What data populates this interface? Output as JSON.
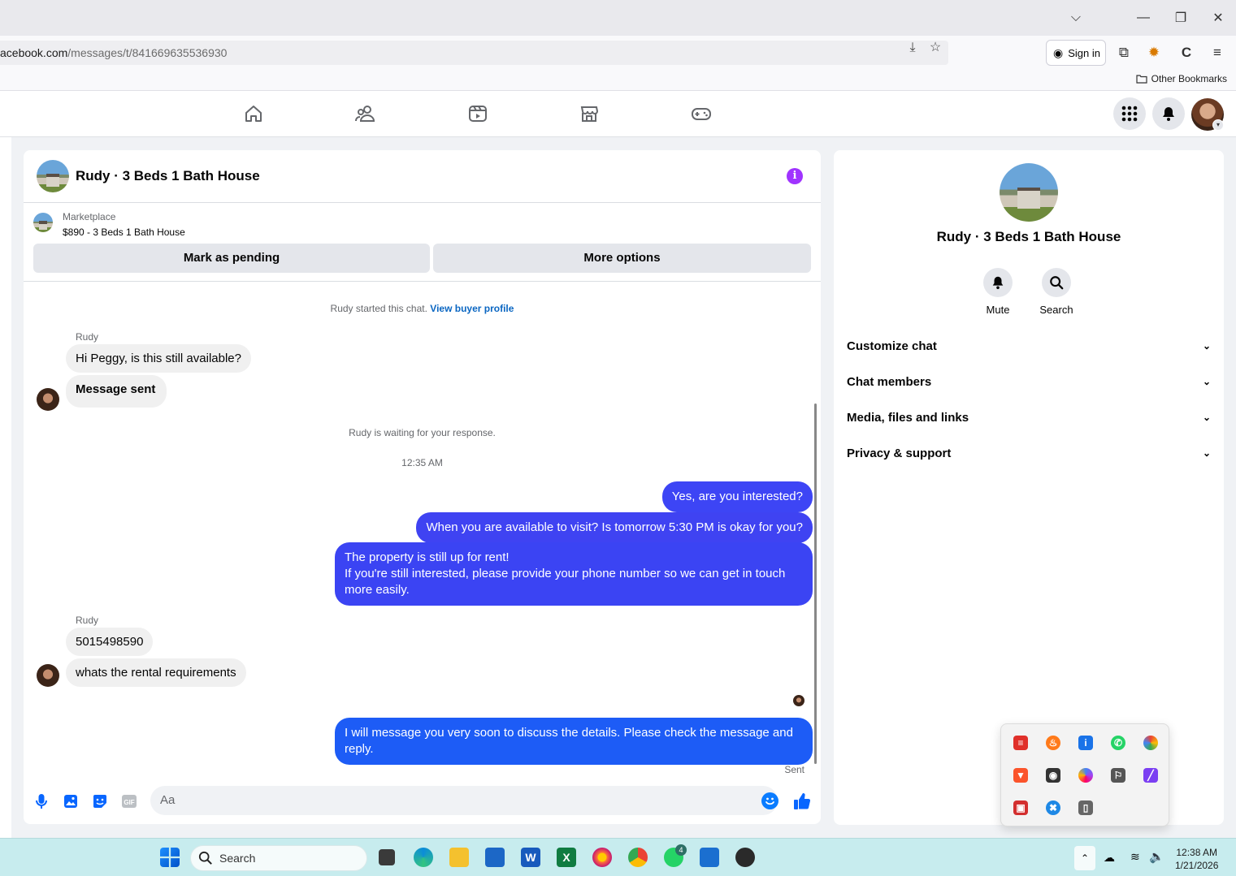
{
  "browser": {
    "url_host": "acebook.com",
    "url_path": "/messages/t/841669635536930",
    "sign_in_label": "Sign in",
    "other_bookmarks_label": "Other Bookmarks"
  },
  "chat": {
    "title": "Rudy · 3 Beds 1 Bath House",
    "marketplace_label": "Marketplace",
    "listing": "$890 - 3 Beds 1 Bath House",
    "mark_pending_label": "Mark as pending",
    "more_options_label": "More options",
    "started_text": "Rudy started this chat.",
    "view_buyer_label": "View buyer profile",
    "sender_name": "Rudy",
    "msg_in_1": "Hi Peggy, is this still available?",
    "msg_in_2": "Message sent",
    "waiting_text": "Rudy is waiting for your response.",
    "timestamp": "12:35 AM",
    "msg_out_1": "Yes, are you interested?",
    "msg_out_2": "When you are available to visit? Is tomorrow 5:30 PM is okay for you?",
    "msg_out_3_line1": "The property is still up for rent!",
    "msg_out_3_line2": "If you're still interested, please provide your phone number so we can get in touch more easily.",
    "msg_in_3": "5015498590",
    "msg_in_4": "whats the rental requirements",
    "msg_out_4": "I will message you very soon to discuss the details. Please check the message and reply.",
    "sent_label": "Sent",
    "composer_placeholder": "Aa"
  },
  "info_panel": {
    "title": "Rudy · 3 Beds 1 Bath House",
    "mute_label": "Mute",
    "search_label": "Search",
    "sections": [
      "Customize chat",
      "Chat members",
      "Media, files and links",
      "Privacy & support"
    ]
  },
  "taskbar": {
    "search_label": "Search",
    "time": "12:38 AM",
    "date": "1/21/2026",
    "whatsapp_badge": "4"
  },
  "colors": {
    "accent": "#0866ff",
    "bubble_out": "#3d45f5",
    "info_icon": "#a033ff"
  }
}
